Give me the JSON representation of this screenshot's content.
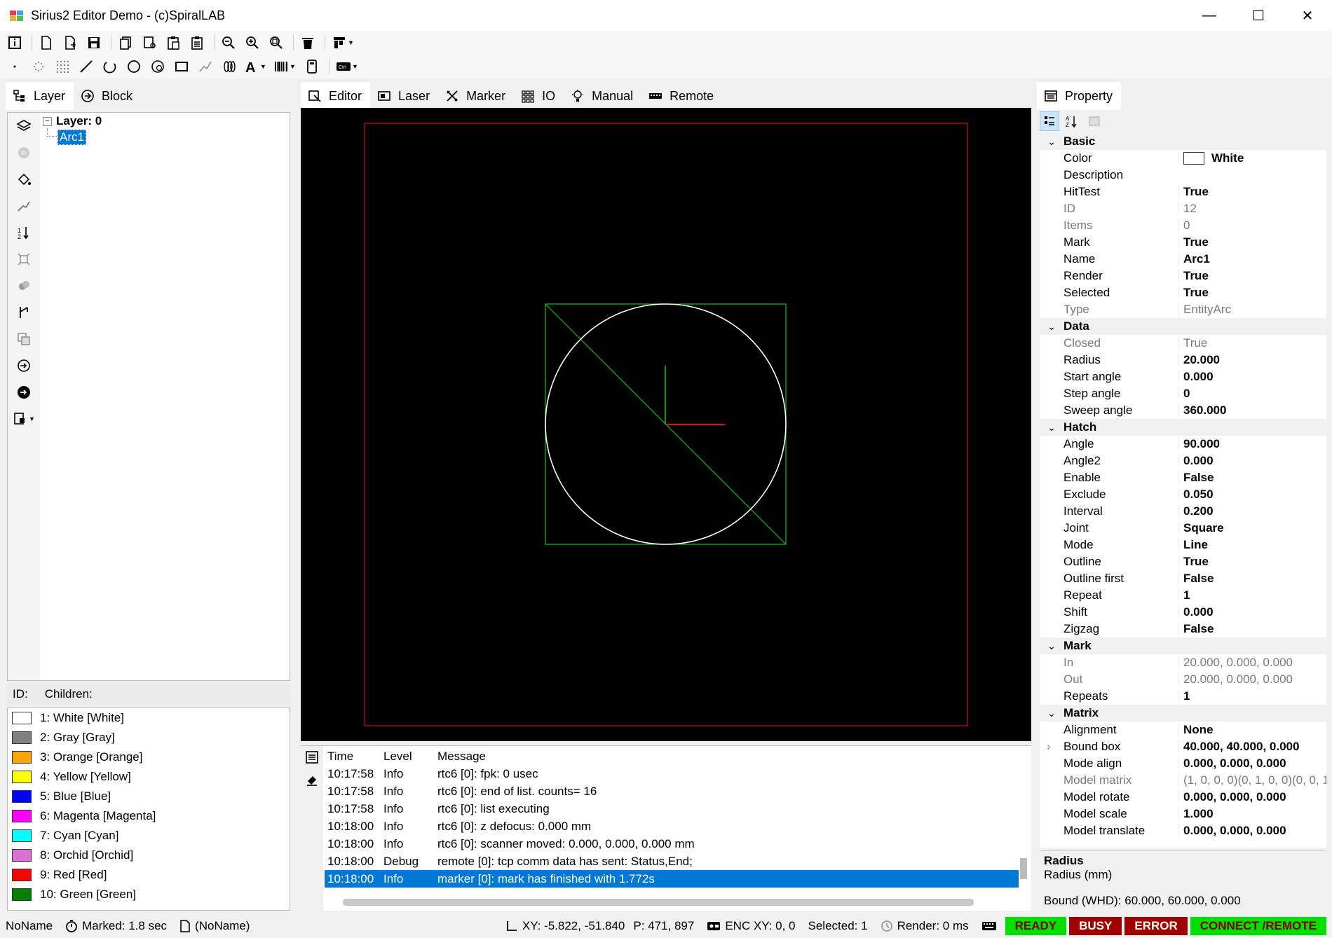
{
  "window": {
    "title": "Sirius2 Editor Demo - (c)SpiralLAB",
    "min_label": "—",
    "max_label": "☐",
    "close_label": "✕"
  },
  "left_tabs": [
    {
      "label": "Layer"
    },
    {
      "label": "Block"
    }
  ],
  "center_tabs": [
    {
      "label": "Editor"
    },
    {
      "label": "Laser"
    },
    {
      "label": "Marker"
    },
    {
      "label": "IO"
    },
    {
      "label": "Manual"
    },
    {
      "label": "Remote"
    }
  ],
  "tree": {
    "root": "Layer: 0",
    "child": "Arc1",
    "root_toggle": "−"
  },
  "id_row": {
    "id_label": "ID:",
    "children_label": "Children:"
  },
  "pens": [
    {
      "label": "1: White [White]",
      "color": "#FFFFFF"
    },
    {
      "label": "2: Gray [Gray]",
      "color": "#808080"
    },
    {
      "label": "3: Orange [Orange]",
      "color": "#FFA500"
    },
    {
      "label": "4: Yellow [Yellow]",
      "color": "#FFFF00"
    },
    {
      "label": "5: Blue [Blue]",
      "color": "#0000FF"
    },
    {
      "label": "6: Magenta [Magenta]",
      "color": "#FF00FF"
    },
    {
      "label": "7: Cyan [Cyan]",
      "color": "#00FFFF"
    },
    {
      "label": "8: Orchid [Orchid]",
      "color": "#DA70D6"
    },
    {
      "label": "9: Red [Red]",
      "color": "#FF0000"
    },
    {
      "label": "10: Green [Green]",
      "color": "#008000"
    }
  ],
  "log": {
    "headers": {
      "time": "Time",
      "level": "Level",
      "message": "Message"
    },
    "rows": [
      {
        "time": "10:17:58",
        "level": "Info",
        "message": "rtc6 [0]: fpk: 0 usec"
      },
      {
        "time": "10:17:58",
        "level": "Info",
        "message": "rtc6 [0]: end of list. counts= 16"
      },
      {
        "time": "10:17:58",
        "level": "Info",
        "message": "rtc6 [0]: list executing"
      },
      {
        "time": "10:18:00",
        "level": "Info",
        "message": "rtc6 [0]: z defocus: 0.000 mm"
      },
      {
        "time": "10:18:00",
        "level": "Info",
        "message": "rtc6 [0]: scanner moved: 0.000, 0.000, 0.000 mm"
      },
      {
        "time": "10:18:00",
        "level": "Debug",
        "message": "remote [0]: tcp comm data has sent: Status,End;"
      },
      {
        "time": "10:18:00",
        "level": "Info",
        "message": "marker [0]: mark has finished with 1.772s"
      }
    ]
  },
  "property": {
    "tab_label": "Property",
    "categories": {
      "basic": "Basic",
      "data": "Data",
      "hatch": "Hatch",
      "mark": "Mark",
      "matrix": "Matrix"
    },
    "basic": [
      {
        "name": "Color",
        "value": "White"
      },
      {
        "name": "Description",
        "value": ""
      },
      {
        "name": "HitTest",
        "value": "True"
      },
      {
        "name": "ID",
        "value": "12"
      },
      {
        "name": "Items",
        "value": "0"
      },
      {
        "name": "Mark",
        "value": "True"
      },
      {
        "name": "Name",
        "value": "Arc1"
      },
      {
        "name": "Render",
        "value": "True"
      },
      {
        "name": "Selected",
        "value": "True"
      },
      {
        "name": "Type",
        "value": "EntityArc"
      }
    ],
    "data": [
      {
        "name": "Closed",
        "value": "True"
      },
      {
        "name": "Radius",
        "value": "20.000"
      },
      {
        "name": "Start angle",
        "value": "0.000"
      },
      {
        "name": "Step angle",
        "value": "0"
      },
      {
        "name": "Sweep angle",
        "value": "360.000"
      }
    ],
    "hatch": [
      {
        "name": "Angle",
        "value": "90.000"
      },
      {
        "name": "Angle2",
        "value": "0.000"
      },
      {
        "name": "Enable",
        "value": "False"
      },
      {
        "name": "Exclude",
        "value": "0.050"
      },
      {
        "name": "Interval",
        "value": "0.200"
      },
      {
        "name": "Joint",
        "value": "Square"
      },
      {
        "name": "Mode",
        "value": "Line"
      },
      {
        "name": "Outline",
        "value": "True"
      },
      {
        "name": "Outline first",
        "value": "False"
      },
      {
        "name": "Repeat",
        "value": "1"
      },
      {
        "name": "Shift",
        "value": "0.000"
      },
      {
        "name": "Zigzag",
        "value": "False"
      }
    ],
    "mark": [
      {
        "name": "In",
        "value": "20.000, 0.000, 0.000"
      },
      {
        "name": "Out",
        "value": "20.000, 0.000, 0.000"
      },
      {
        "name": "Repeats",
        "value": "1"
      }
    ],
    "matrix": [
      {
        "name": "Alignment",
        "value": "None"
      },
      {
        "name": "Bound box",
        "value": "40.000, 40.000, 0.000"
      },
      {
        "name": "Mode align",
        "value": "0.000, 0.000, 0.000"
      },
      {
        "name": "Model matrix",
        "value": "(1, 0, 0, 0)(0, 1, 0, 0)(0, 0, 1"
      },
      {
        "name": "Model rotate",
        "value": "0.000, 0.000, 0.000"
      },
      {
        "name": "Model scale",
        "value": "1.000"
      },
      {
        "name": "Model translate",
        "value": "0.000, 0.000, 0.000"
      }
    ],
    "desc_title": "Radius",
    "desc_text": "Radius (mm)",
    "bound": "Bound (WHD): 60.000, 60.000, 0.000"
  },
  "status": {
    "name": "NoName",
    "marked": "Marked: 1.8 sec",
    "doc": "(NoName)",
    "xy": "XY: -5.822, -51.840",
    "p": "P: 471, 897",
    "enc": "ENC XY: 0, 0",
    "selected": "Selected: 1",
    "render": "Render: 0 ms",
    "ready": "READY",
    "busy": "BUSY",
    "error": "ERROR",
    "connect": "CONNECT /REMOTE"
  },
  "icons": {
    "toolbar1": [
      "info-icon",
      "new-file-icon",
      "new-doc-icon",
      "save-icon",
      "copy-icon",
      "cut-icon",
      "paste-icon",
      "clipboard-icon",
      "zoom-out-icon",
      "zoom-in-icon",
      "zoom-fit-icon",
      "delete-icon",
      "align-icon"
    ],
    "toolbar2": [
      "point-icon",
      "points-icon",
      "raster-icon",
      "line-icon",
      "arc-icon",
      "circle-icon",
      "trepan-icon",
      "rectangle-icon",
      "polyline-icon",
      "spiral-icon",
      "text-icon",
      "barcode-icon",
      "sirius-text-icon",
      "ctrl-icon"
    ]
  },
  "colors": {
    "selection": "#0078d7",
    "ready": "#00e000",
    "busy": "#c00000",
    "error": "#c00000",
    "connect": "#00e000"
  }
}
